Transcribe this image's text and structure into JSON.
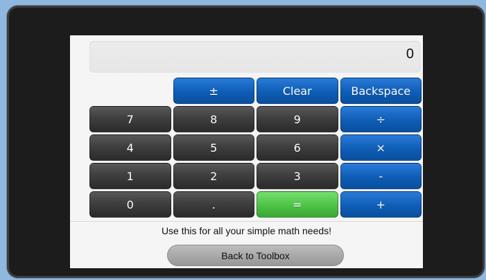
{
  "colors": {
    "background": "#8fb7e0",
    "bezel": "#1c1c1c",
    "screen": "#f5f5f5",
    "key_dark": "#3f3f3f",
    "key_blue": "#0e5db6",
    "key_green": "#4bbf44"
  },
  "display": {
    "value": "0"
  },
  "keys": {
    "plus_minus": "±",
    "clear": "Clear",
    "backspace": "Backspace",
    "seven": "7",
    "eight": "8",
    "nine": "9",
    "divide": "÷",
    "four": "4",
    "five": "5",
    "six": "6",
    "multiply": "×",
    "one": "1",
    "two": "2",
    "three": "3",
    "minus": "-",
    "zero": "0",
    "decimal": ".",
    "equals": "=",
    "plus": "+"
  },
  "footer": {
    "message": "Use this for all your simple math needs!",
    "back_label": "Back to Toolbox"
  }
}
